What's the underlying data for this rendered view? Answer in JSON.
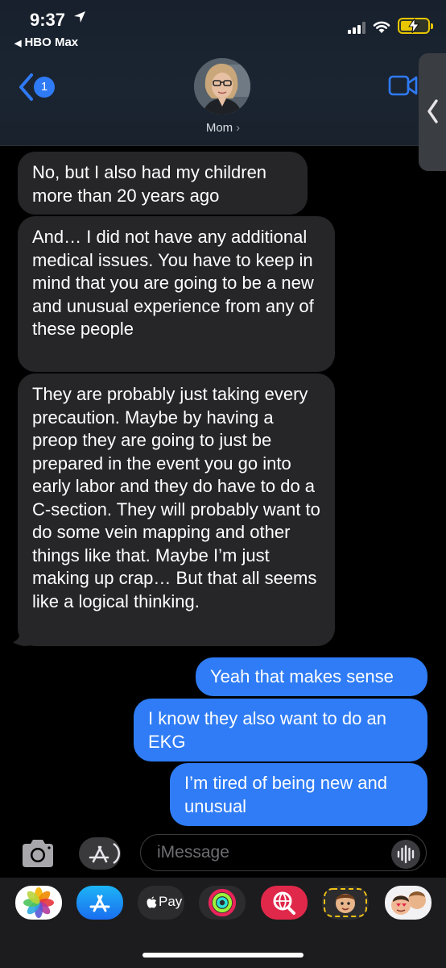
{
  "status_bar": {
    "time": "9:37",
    "back_app": "HBO Max"
  },
  "header": {
    "unread_count": "1",
    "contact_name": "Mom"
  },
  "messages": [
    {
      "direction": "incoming",
      "text": "No, but I also had my children more than 20 years ago"
    },
    {
      "direction": "incoming",
      "text": "And… I did not have any additional medical issues. You have to keep in mind that you are going to be a new and unusual experience from any of these people"
    },
    {
      "direction": "incoming",
      "text": "They are probably just taking every precaution. Maybe by having a preop they are going to just be prepared in the event you go into early labor and they do have to do a C-section. They will probably want to do some vein mapping and other things like that. Maybe I’m just making up crap… But that all seems like a logical thinking."
    },
    {
      "direction": "outgoing",
      "text": "Yeah that makes sense"
    },
    {
      "direction": "outgoing",
      "text": "I know they also want to do an EKG"
    },
    {
      "direction": "outgoing",
      "text": "I’m tired of being new and unusual"
    }
  ],
  "composer": {
    "placeholder": "iMessage"
  },
  "app_tray": {
    "apple_pay_label": "Pay",
    "apps": [
      "photos-icon",
      "app-store-icon",
      "apple-pay-icon",
      "activity-icon",
      "web-search-icon",
      "memoji-icon",
      "memoji-stickers-icon"
    ]
  },
  "colors": {
    "outgoing_bubble": "#2f7cf6",
    "incoming_bubble": "#262629",
    "accent": "#2f7af5",
    "battery": "#e8c600"
  }
}
